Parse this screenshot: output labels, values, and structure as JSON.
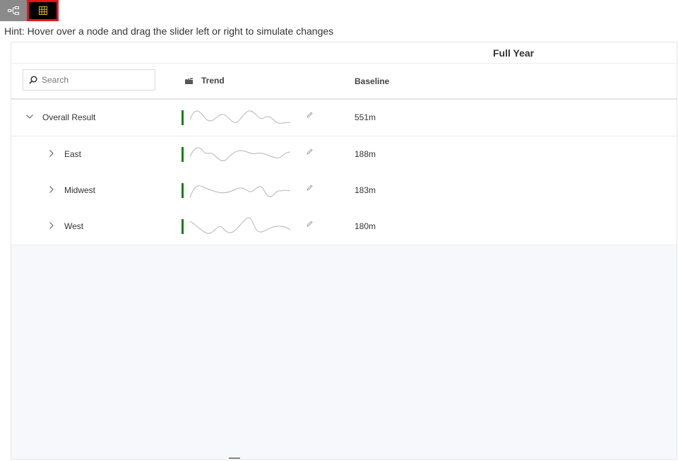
{
  "toolbar": {
    "buttons": [
      {
        "icon": "tree-view-icon",
        "active": false
      },
      {
        "icon": "grid-view-icon",
        "active": true,
        "icon_color": "#e0b030",
        "outline_color": "#e8141b"
      }
    ]
  },
  "hint": "Hint: Hover over a node and drag the slider left or right to simulate changes",
  "grid": {
    "period_header": "Full Year",
    "search": {
      "placeholder": "Search",
      "value": ""
    },
    "columns": {
      "trend": "Trend",
      "baseline": "Baseline"
    },
    "rows": [
      {
        "label": "Overall Result",
        "expanded": true,
        "level": 0,
        "baseline": "551m",
        "trend_icon": "sparkline",
        "status_color": "#1a7d1a"
      },
      {
        "label": "East",
        "expanded": false,
        "level": 1,
        "baseline": "188m",
        "trend_icon": "sparkline",
        "status_color": "#1a7d1a"
      },
      {
        "label": "Midwest",
        "expanded": false,
        "level": 1,
        "baseline": "183m",
        "trend_icon": "sparkline",
        "status_color": "#1a7d1a"
      },
      {
        "label": "West",
        "expanded": false,
        "level": 1,
        "baseline": "180m",
        "trend_icon": "sparkline",
        "status_color": "#1a7d1a"
      }
    ]
  }
}
